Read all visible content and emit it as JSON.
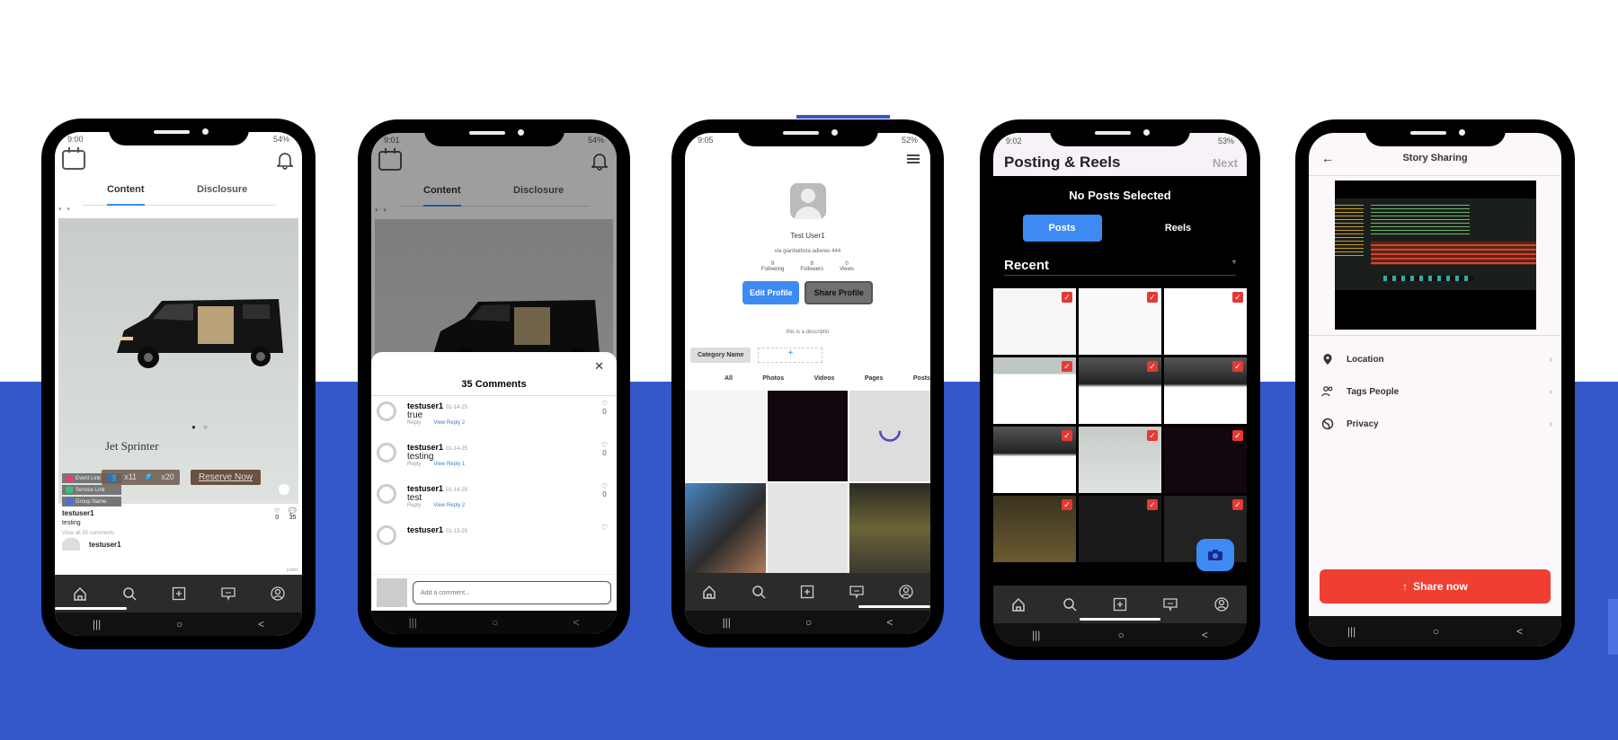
{
  "colors": {
    "band": "#3457c9",
    "accent_blue": "#3d8bf2",
    "danger_red": "#ef3f33",
    "tab_underline": "#3a8ee6"
  },
  "feed": {
    "status": {
      "time": "9:00",
      "battery": "54%"
    },
    "tabs": [
      "Content",
      "Disclosure"
    ],
    "post": {
      "title": "Jet Sprinter",
      "chips": [
        "Event Link",
        "Service Link",
        "Group Name"
      ],
      "seats": "x11",
      "bags": "x20",
      "reserve": "Reserve Now",
      "user": "testuser1",
      "caption": "testing",
      "view_all": "View all 35 comments",
      "comment_user": "testuser1",
      "visibility": "public",
      "likes": "0",
      "comments": "35"
    }
  },
  "comments_screen": {
    "status": {
      "time": "9:01",
      "battery": "54%"
    },
    "title": "35 Comments",
    "items": [
      {
        "user": "testuser1",
        "date": "01-14-25",
        "text": "true",
        "reply": "Reply",
        "view": "View Reply 2",
        "likes": "0"
      },
      {
        "user": "testuser1",
        "date": "01-14-25",
        "text": "testing",
        "reply": "Reply",
        "view": "View Reply 1",
        "likes": "0"
      },
      {
        "user": "testuser1",
        "date": "01-14-25",
        "text": "test",
        "reply": "Reply",
        "view": "View Reply 2",
        "likes": "0"
      },
      {
        "user": "testuser1",
        "date": "01-13-25",
        "text": "",
        "reply": "",
        "view": "",
        "likes": ""
      }
    ],
    "input_placeholder": "Add a comment..."
  },
  "profile": {
    "status": {
      "time": "9:05",
      "battery": "52%"
    },
    "name": "Test User1",
    "address": "via gianbattista adiereo 444",
    "stats": [
      {
        "value": "9",
        "label": "Following"
      },
      {
        "value": "8",
        "label": "Followers"
      },
      {
        "value": "0",
        "label": "Views"
      }
    ],
    "edit": "Edit Profile",
    "share": "Share Profile",
    "description": "this is a descriptio",
    "category": "Category Name",
    "add": "+",
    "tabs": [
      "All",
      "Photos",
      "Videos",
      "Pages",
      "Posts"
    ]
  },
  "posting": {
    "status": {
      "time": "9:02",
      "battery": "53%"
    },
    "title": "Posting & Reels",
    "next": "Next",
    "empty": "No Posts Selected",
    "toggle": [
      "Posts",
      "Reels"
    ],
    "recent": "Recent",
    "dropdown": "▾"
  },
  "story": {
    "title": "Story Sharing",
    "back": "←",
    "items": [
      {
        "label": "Location",
        "icon": "location-pin-icon"
      },
      {
        "label": "Tags People",
        "icon": "people-icon"
      },
      {
        "label": "Privacy",
        "icon": "globe-icon"
      }
    ],
    "share": "Share now",
    "share_icon": "↑"
  },
  "sysnav": [
    "|||",
    "○",
    "<"
  ]
}
